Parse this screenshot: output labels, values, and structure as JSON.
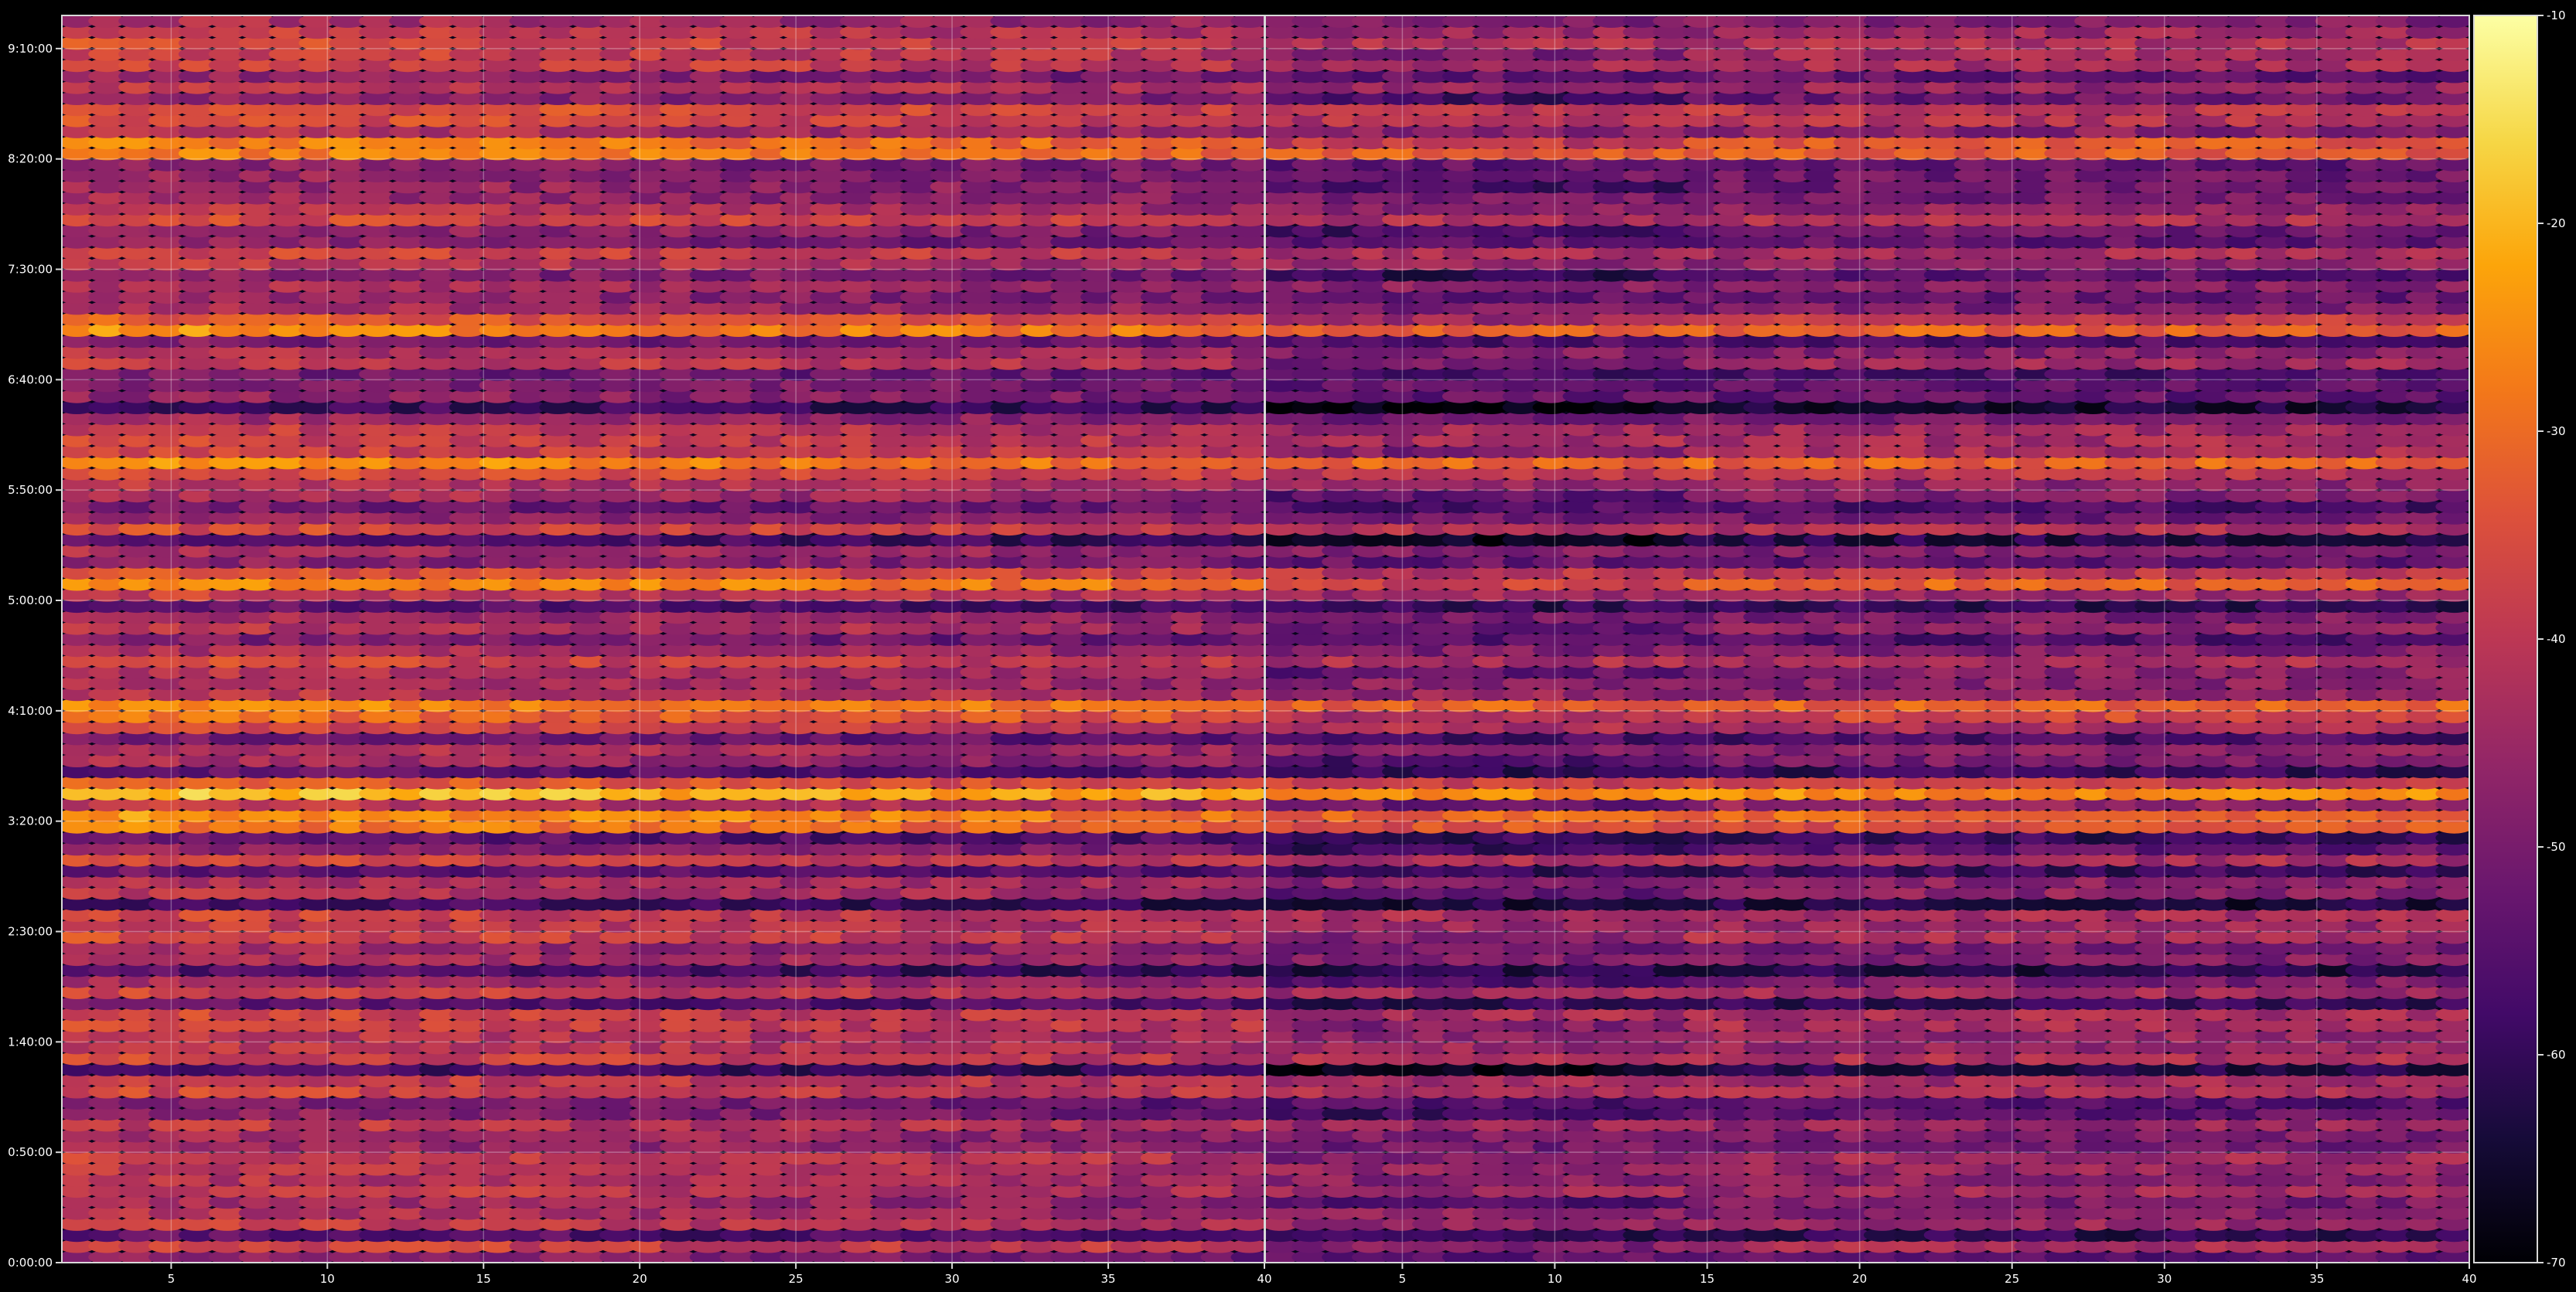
{
  "chart_data": {
    "type": "heatmap",
    "panels": [
      {
        "x_ticks": [
          "5",
          "10",
          "15",
          "20",
          "25",
          "30",
          "35",
          "40"
        ],
        "x_tick_values": [
          5,
          10,
          15,
          20,
          25,
          30,
          35,
          40
        ],
        "xlim": [
          1.5,
          40
        ]
      },
      {
        "x_ticks": [
          "5",
          "10",
          "15",
          "20",
          "25",
          "30",
          "35",
          "40"
        ],
        "x_tick_values": [
          5,
          10,
          15,
          20,
          25,
          30,
          35,
          40
        ],
        "xlim": [
          0.5,
          40
        ]
      }
    ],
    "y_ticks": [
      "0:00:00",
      "0:50:00",
      "1:40:00",
      "2:30:00",
      "3:20:00",
      "4:10:00",
      "5:00:00",
      "5:50:00",
      "6:40:00",
      "7:30:00",
      "8:20:00",
      "9:10:00"
    ],
    "y_tick_minutes": [
      0,
      50,
      100,
      150,
      200,
      250,
      300,
      350,
      400,
      450,
      500,
      550
    ],
    "ylim_minutes": [
      0,
      565
    ],
    "row_count": 113,
    "colorbar": {
      "colormap": "inferno",
      "range": [
        -70,
        -10
      ],
      "ticks": [
        "-10",
        "-20",
        "-30",
        "-40",
        "-50",
        "-60",
        "-70"
      ],
      "tick_values": [
        -10,
        -20,
        -30,
        -40,
        -50,
        -60,
        -70
      ]
    },
    "grid": true,
    "approx_row_level": "mean level per time row is roughly -35 to -45 in the left panel and -45 to -55 in the right panel; bright bands near -20 at about 3:20, 4:10, 5:10 and 8:50"
  }
}
